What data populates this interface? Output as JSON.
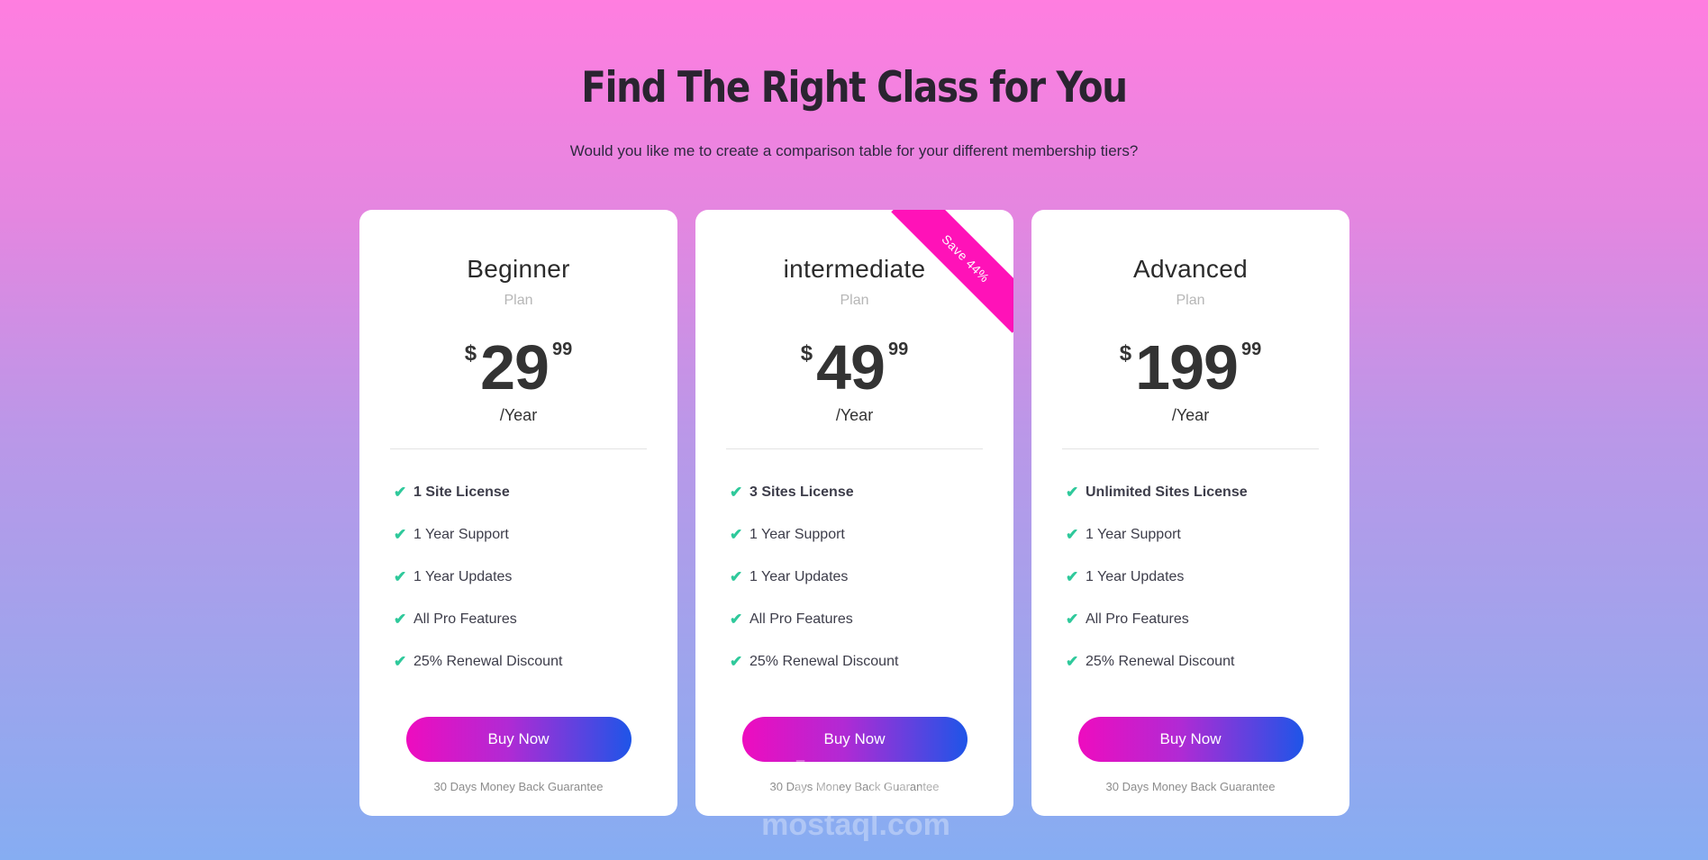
{
  "header": {
    "title": "Find The Right Class for You",
    "subtitle": "Would you like me to create a comparison table for your different membership tiers?"
  },
  "plans": [
    {
      "name": "Beginner",
      "sub": "Plan",
      "currency": "$",
      "amount": "29",
      "cents": "99",
      "period": "/Year",
      "features": [
        "1 Site License",
        "1 Year Support",
        "1 Year Updates",
        "All Pro Features",
        "25% Renewal Discount"
      ],
      "button": "Buy Now",
      "guarantee": "30 Days Money Back Guarantee"
    },
    {
      "name": "intermediate",
      "sub": "Plan",
      "currency": "$",
      "amount": "49",
      "cents": "99",
      "period": "/Year",
      "ribbon": "Save 44%",
      "features": [
        "3 Sites License",
        "1 Year Support",
        "1 Year Updates",
        "All Pro Features",
        "25% Renewal Discount"
      ],
      "button": "Buy Now",
      "guarantee": "30 Days Money Back Guarantee"
    },
    {
      "name": "Advanced",
      "sub": "Plan",
      "currency": "$",
      "amount": "199",
      "cents": "99",
      "period": "/Year",
      "features": [
        "Unlimited Sites License",
        "1 Year Support",
        "1 Year Updates",
        "All Pro Features",
        "25% Renewal Discount"
      ],
      "button": "Buy Now",
      "guarantee": "30 Days Money Back Guarantee"
    }
  ],
  "icons": {
    "feature": "check-icon"
  },
  "watermark": {
    "arabic": "مستقل",
    "latin": "mostaql.com"
  },
  "colors": {
    "accent_pink": "#ff12b8",
    "button_gradient_start": "#ee0cbf",
    "button_gradient_end": "#1e55e8",
    "check_green": "#2fc99b"
  }
}
